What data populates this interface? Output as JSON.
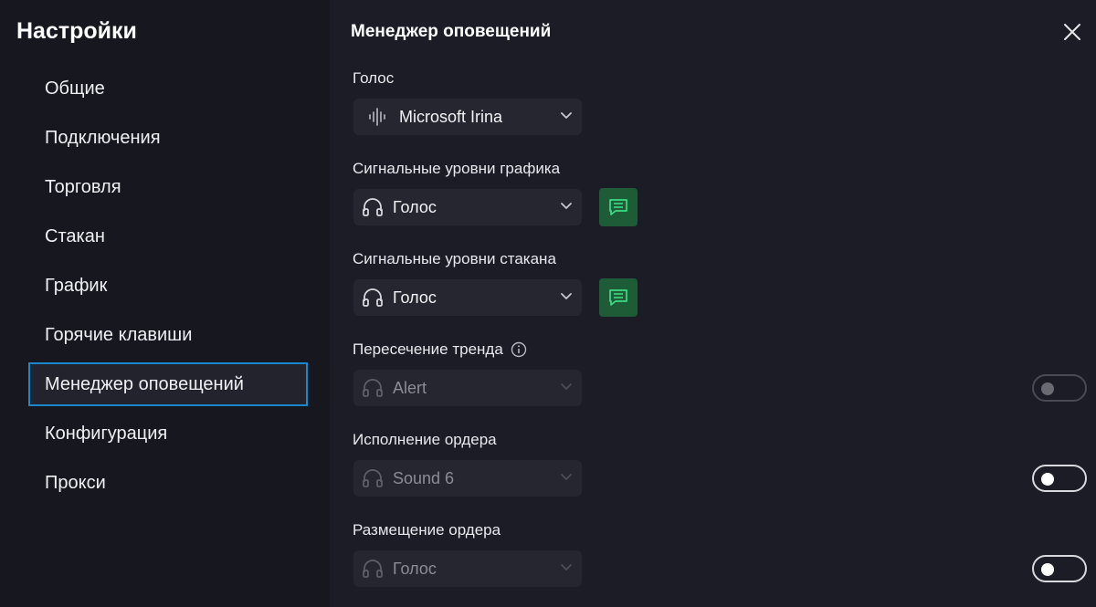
{
  "sidebar": {
    "title": "Настройки",
    "items": [
      {
        "label": "Общие"
      },
      {
        "label": "Подключения"
      },
      {
        "label": "Торговля"
      },
      {
        "label": "Стакан"
      },
      {
        "label": "График"
      },
      {
        "label": "Горячие клавиши"
      },
      {
        "label": "Менеджер оповещений",
        "active": true
      },
      {
        "label": "Конфигурация"
      },
      {
        "label": "Прокси"
      }
    ]
  },
  "main": {
    "title": "Менеджер оповещений",
    "voice": {
      "label": "Голос",
      "value": "Microsoft Irina",
      "icon": "waveform-icon"
    },
    "chart_levels": {
      "label": "Сигнальные уровни графика",
      "value": "Голос",
      "icon": "headphones-icon"
    },
    "dom_levels": {
      "label": "Сигнальные уровни стакана",
      "value": "Голос",
      "icon": "headphones-icon"
    },
    "trend_cross": {
      "label": "Пересечение тренда",
      "value": "Alert",
      "enabled": false,
      "icon": "headphones-icon"
    },
    "order_exec": {
      "label": "Исполнение ордера",
      "value": "Sound 6",
      "enabled": false,
      "icon": "headphones-icon"
    },
    "order_place": {
      "label": "Размещение ордера",
      "value": "Голос",
      "enabled": false,
      "icon": "headphones-icon"
    }
  },
  "colors": {
    "accent_border": "#1b86c9",
    "message_button": "#1d5c37",
    "message_icon": "#3ddc84",
    "background": "#1c1c27",
    "sidebar": "#171720"
  }
}
